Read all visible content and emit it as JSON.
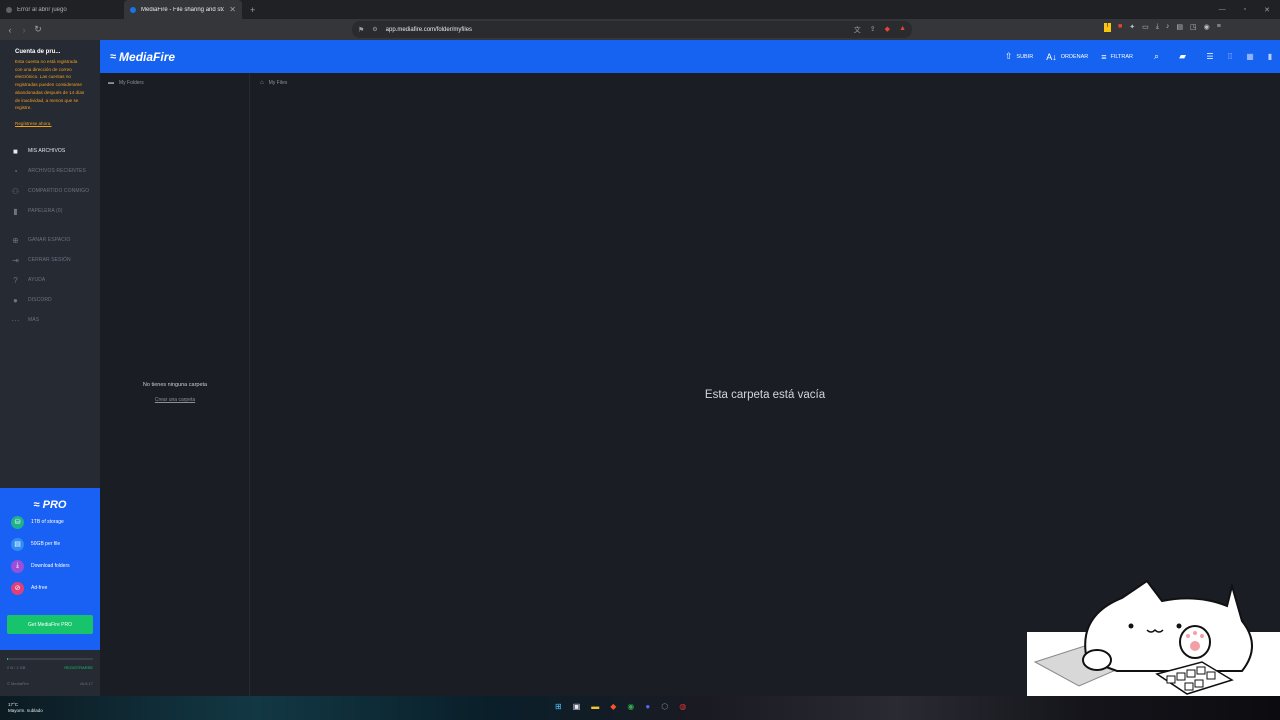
{
  "browser": {
    "tabs": [
      {
        "title": "Error al abrir juego",
        "active": false
      },
      {
        "title": "MediaFire - File sharing and sto",
        "active": true
      }
    ],
    "url": "app.mediafire.com/folder/myfiles"
  },
  "account": {
    "title": "Cuenta de pru...",
    "warning": "Esta cuenta no está registrada con una dirección de correo electrónico. Las cuentas no registradas pueden considerarse abandonadas después de 14 días de inactividad, a menos que se registre.",
    "register_link": "Regístrese ahora."
  },
  "sidebar": {
    "items": [
      {
        "label": "MIS ARCHIVOS",
        "icon": "folder-icon",
        "active": true
      },
      {
        "label": "ARCHIVOS RECIENTES",
        "icon": "clock-icon",
        "active": false
      },
      {
        "label": "COMPARTIDO CONMIGO",
        "icon": "people-icon",
        "active": false
      },
      {
        "label": "PAPELERA (0)",
        "icon": "trash-icon",
        "active": false
      }
    ],
    "secondary": [
      {
        "label": "GANAR ESPACIO",
        "icon": "plus-circle-icon"
      },
      {
        "label": "CERRAR SESIÓN",
        "icon": "logout-icon"
      },
      {
        "label": "AYUDA",
        "icon": "help-icon"
      },
      {
        "label": "DISCORD",
        "icon": "discord-icon"
      },
      {
        "label": "MÁS",
        "icon": "more-icon"
      }
    ]
  },
  "pro": {
    "logo": "PRO",
    "features": [
      {
        "label": "1TB of storage",
        "color": "#1fb28a"
      },
      {
        "label": "50GB per file",
        "color": "#2f8cf3"
      },
      {
        "label": "Download folders",
        "color": "#9b4fd8"
      },
      {
        "label": "Ad-free",
        "color": "#e0407a"
      }
    ],
    "cta": "Get MediaFire PRO",
    "storage_used": "0 B / 1 GB",
    "storage_fraction": 0.0,
    "register": "REGISTRARSE",
    "brand": "© MediaFire",
    "version": "v5.8.17"
  },
  "header": {
    "logo": "MediaFire",
    "tools": [
      {
        "label": "SUBIR",
        "icon": "upload-icon"
      },
      {
        "label": "ORDENAR",
        "icon": "sort-az-icon"
      },
      {
        "label": "FILTRAR",
        "icon": "filter-icon"
      }
    ]
  },
  "folders": {
    "heading": "My Folders",
    "empty": "No tienes ninguna carpeta",
    "create": "Crear una carpeta"
  },
  "files": {
    "heading": "My Files",
    "empty": "Esta carpeta está vacía"
  },
  "taskbar": {
    "temp": "17°C",
    "weather": "Mayorm. nublado"
  },
  "colors": {
    "accent": "#1563f0",
    "sidebar": "#262a33",
    "background": "#1b1d25",
    "pro_green": "#17c46b",
    "warning": "#f0a020"
  }
}
